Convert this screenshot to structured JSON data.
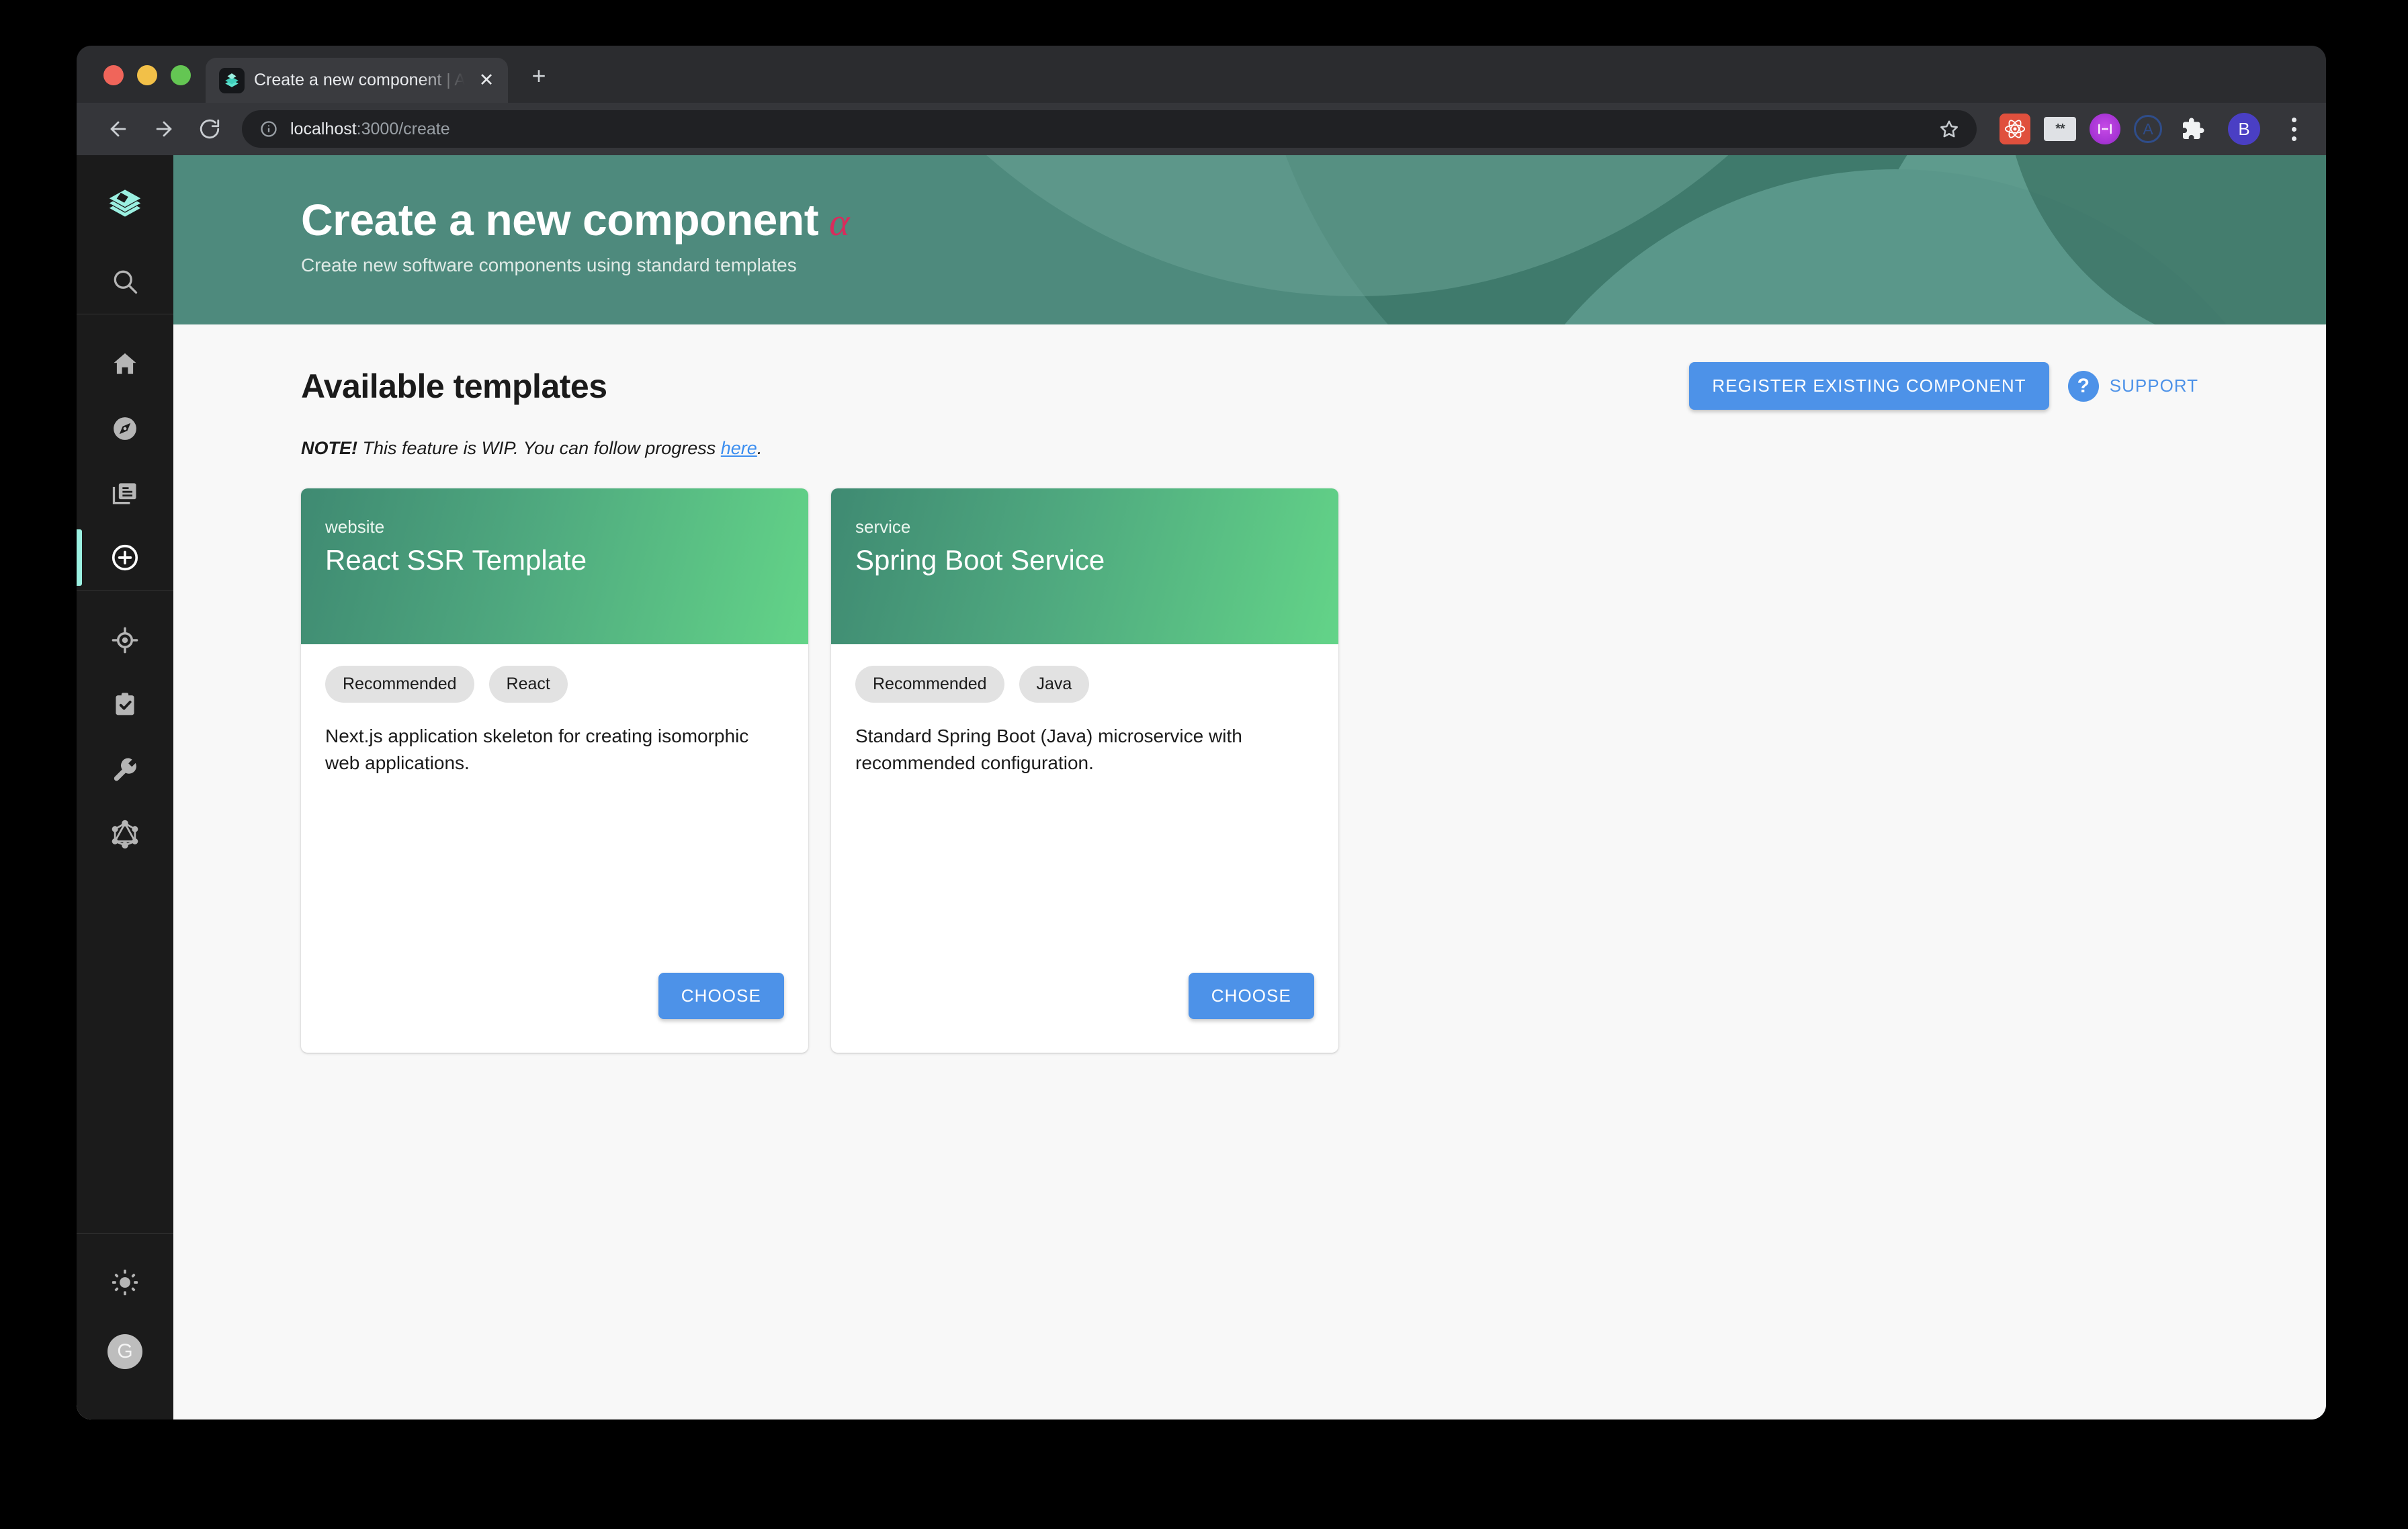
{
  "browser": {
    "tab": {
      "title": "Create a new component | Avai",
      "favicon_icon": "backstage-logo-icon",
      "close_icon": "close-icon"
    },
    "new_tab_icon": "plus-icon",
    "toolbar": {
      "back_icon": "back-arrow-icon",
      "forward_icon": "forward-arrow-icon",
      "reload_icon": "reload-icon",
      "info_icon": "info-circle-icon",
      "star_icon": "star-icon",
      "url_host": "localhost",
      "url_path": ":3000/create",
      "extensions": [
        {
          "name": "react-devtools-icon",
          "label": ""
        },
        {
          "name": "regex-tester-icon",
          "label": "**"
        },
        {
          "name": "purple-face-icon",
          "label": ":···:"
        },
        {
          "name": "circle-a-icon",
          "label": "A"
        },
        {
          "name": "puzzle-extensions-icon",
          "label": ""
        }
      ],
      "profile_initial": "B",
      "menu_icon": "kebab-menu-icon"
    }
  },
  "sidebar": {
    "logo_icon": "backstage-logo-icon",
    "items": [
      {
        "name": "sidebar-item-search",
        "icon": "search-icon"
      },
      {
        "name": "sidebar-item-home",
        "icon": "home-icon"
      },
      {
        "name": "sidebar-item-explore",
        "icon": "compass-icon"
      },
      {
        "name": "sidebar-item-docs",
        "icon": "library-books-icon"
      },
      {
        "name": "sidebar-item-create",
        "icon": "add-circle-icon"
      },
      {
        "name": "sidebar-item-tech-radar",
        "icon": "target-icon"
      },
      {
        "name": "sidebar-item-tasks",
        "icon": "clipboard-check-icon"
      },
      {
        "name": "sidebar-item-tools",
        "icon": "wrench-icon"
      },
      {
        "name": "sidebar-item-graphiql",
        "icon": "graphql-icon"
      }
    ],
    "bottom": {
      "theme_toggle_icon": "sun-icon",
      "avatar_initial": "G"
    },
    "active_indicator_color": "#9bf0e1"
  },
  "header": {
    "title": "Create a new component",
    "alpha_badge": "α",
    "subtitle": "Create new software components using standard templates",
    "background_color": "#4e8a7d"
  },
  "main": {
    "section_title": "Available templates",
    "register_button_label": "REGISTER EXISTING COMPONENT",
    "support": {
      "icon": "help-circle-icon",
      "label": "SUPPORT"
    },
    "note": {
      "bold_prefix": "NOTE!",
      "text": " This feature is WIP. You can follow progress ",
      "link_text": "here",
      "suffix": "."
    },
    "accent_color": "#4d92e8",
    "templates": [
      {
        "kind": "website",
        "name": "React SSR Template",
        "tags": [
          "Recommended",
          "React"
        ],
        "description": "Next.js application skeleton for creating isomorphic web applications.",
        "choose_label": "CHOOSE"
      },
      {
        "kind": "service",
        "name": "Spring Boot Service",
        "tags": [
          "Recommended",
          "Java"
        ],
        "description": "Standard Spring Boot (Java) microservice with recommended configuration.",
        "choose_label": "CHOOSE"
      }
    ]
  }
}
